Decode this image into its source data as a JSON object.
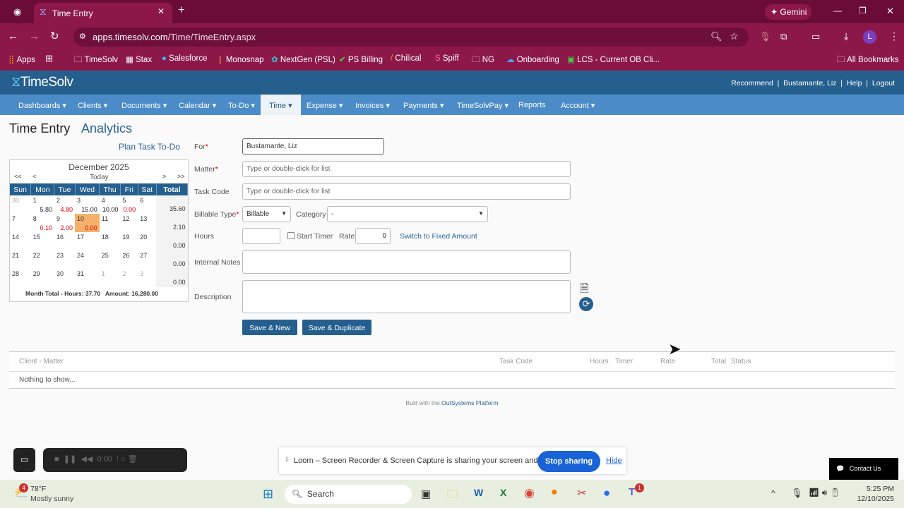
{
  "browser": {
    "tab_title": "Time Entry",
    "url_host": "apps.timesolv.com",
    "url_path": "/Time/TimeEntry.aspx",
    "gemini": "Gemini",
    "profile": "L",
    "bookmarks": [
      "Apps",
      "TimeSolv",
      "Stax",
      "Salesforce",
      "Monosnap",
      "NextGen (PSL)",
      "PS Billing",
      "Chilical",
      "Spiff",
      "NG",
      "Onboarding",
      "LCS - Current OB Cli..."
    ],
    "all_bookmarks": "All Bookmarks"
  },
  "app": {
    "logo": "TimeSolv",
    "header_links": [
      "Recommend",
      "Bustamante, Liz",
      "Help",
      "Logout"
    ],
    "nav": [
      "Dashboards",
      "Clients",
      "Documents",
      "Calendar",
      "To-Do",
      "Time",
      "Expense",
      "Invoices",
      "Payments",
      "TimeSolvPay",
      "Reports",
      "Account"
    ],
    "active_nav": "Time"
  },
  "page": {
    "title": "Time Entry",
    "analytics": "Analytics",
    "plan_task": "Plan Task To-Do"
  },
  "calendar": {
    "month": "December 2025",
    "prev_year": "<<",
    "prev": "<",
    "today": "Today",
    "next": ">",
    "next_year": ">>",
    "headers": [
      "Sun",
      "Mon",
      "Tue",
      "Wed",
      "Thu",
      "Fri",
      "Sat",
      "Total"
    ],
    "weeks": [
      {
        "days": [
          [
            "30",
            "",
            ""
          ],
          [
            "1",
            "5.80",
            "navy"
          ],
          [
            "2",
            "4.80",
            "red"
          ],
          [
            "3",
            "15.00",
            "navy"
          ],
          [
            "4",
            "10.00",
            "navy"
          ],
          [
            "5",
            "0.00",
            "red"
          ],
          [
            "6",
            "",
            ""
          ]
        ],
        "total": "35.60"
      },
      {
        "days": [
          [
            "7",
            "",
            ""
          ],
          [
            "8",
            "0.10",
            "red"
          ],
          [
            "9",
            "2.00",
            "red"
          ],
          [
            "10",
            "0.00",
            "red"
          ],
          [
            "11",
            "",
            ""
          ],
          [
            "12",
            "",
            ""
          ],
          [
            "13",
            "",
            ""
          ]
        ],
        "total": "2.10"
      },
      {
        "days": [
          [
            "14",
            "",
            ""
          ],
          [
            "15",
            "",
            ""
          ],
          [
            "16",
            "",
            ""
          ],
          [
            "17",
            "",
            ""
          ],
          [
            "18",
            "",
            ""
          ],
          [
            "19",
            "",
            ""
          ],
          [
            "20",
            "",
            ""
          ]
        ],
        "total": "0.00"
      },
      {
        "days": [
          [
            "21",
            "",
            ""
          ],
          [
            "22",
            "",
            ""
          ],
          [
            "23",
            "",
            ""
          ],
          [
            "24",
            "",
            ""
          ],
          [
            "25",
            "",
            ""
          ],
          [
            "26",
            "",
            ""
          ],
          [
            "27",
            "",
            ""
          ]
        ],
        "total": "0.00"
      },
      {
        "days": [
          [
            "28",
            "",
            ""
          ],
          [
            "29",
            "",
            ""
          ],
          [
            "30",
            "",
            ""
          ],
          [
            "31",
            "",
            ""
          ],
          [
            "1",
            "",
            ""
          ],
          [
            "2",
            "",
            ""
          ],
          [
            "3",
            "",
            ""
          ]
        ],
        "total": "0.00"
      }
    ],
    "month_total": "Month Total - Hours: 37.70   Amount: 16,280.00"
  },
  "form": {
    "for_label": "For",
    "for_value": "Bustamante, Liz",
    "matter_label": "Matter",
    "matter_ph": "Type or double-click for list",
    "task_label": "Task Code",
    "task_ph": "Type or double-click for list",
    "billable_label": "Billable Type",
    "billable_value": "Billable",
    "category_label": "Category",
    "category_value": "-",
    "hours_label": "Hours",
    "start_timer": "Start Timer",
    "rate_label": "Rate",
    "rate_value": "0",
    "switch_fixed": "Switch to Fixed Amount",
    "notes_label": "Internal Notes",
    "desc_label": "Description",
    "save_new": "Save & New",
    "save_dup": "Save & Duplicate"
  },
  "grid": {
    "headers": [
      "Client - Matter",
      "Task Code",
      "Hours",
      "Timer",
      "Rate",
      "Total",
      "Status"
    ],
    "empty": "Nothing to show..."
  },
  "footer": {
    "built": "Built with the",
    "platform": "OutSystems Platform"
  },
  "loom": {
    "timer": "0:00",
    "message": "Loom – Screen Recorder & Screen Capture is sharing your screen and audio.",
    "stop": "Stop sharing",
    "hide": "Hide"
  },
  "contact": "Contact Us",
  "taskbar": {
    "weather_temp": "78°F",
    "weather_desc": "Mostly sunny",
    "weather_badge": "4",
    "search": "Search",
    "teams_badge": "1",
    "time": "5:25 PM",
    "date": "12/10/2025"
  }
}
